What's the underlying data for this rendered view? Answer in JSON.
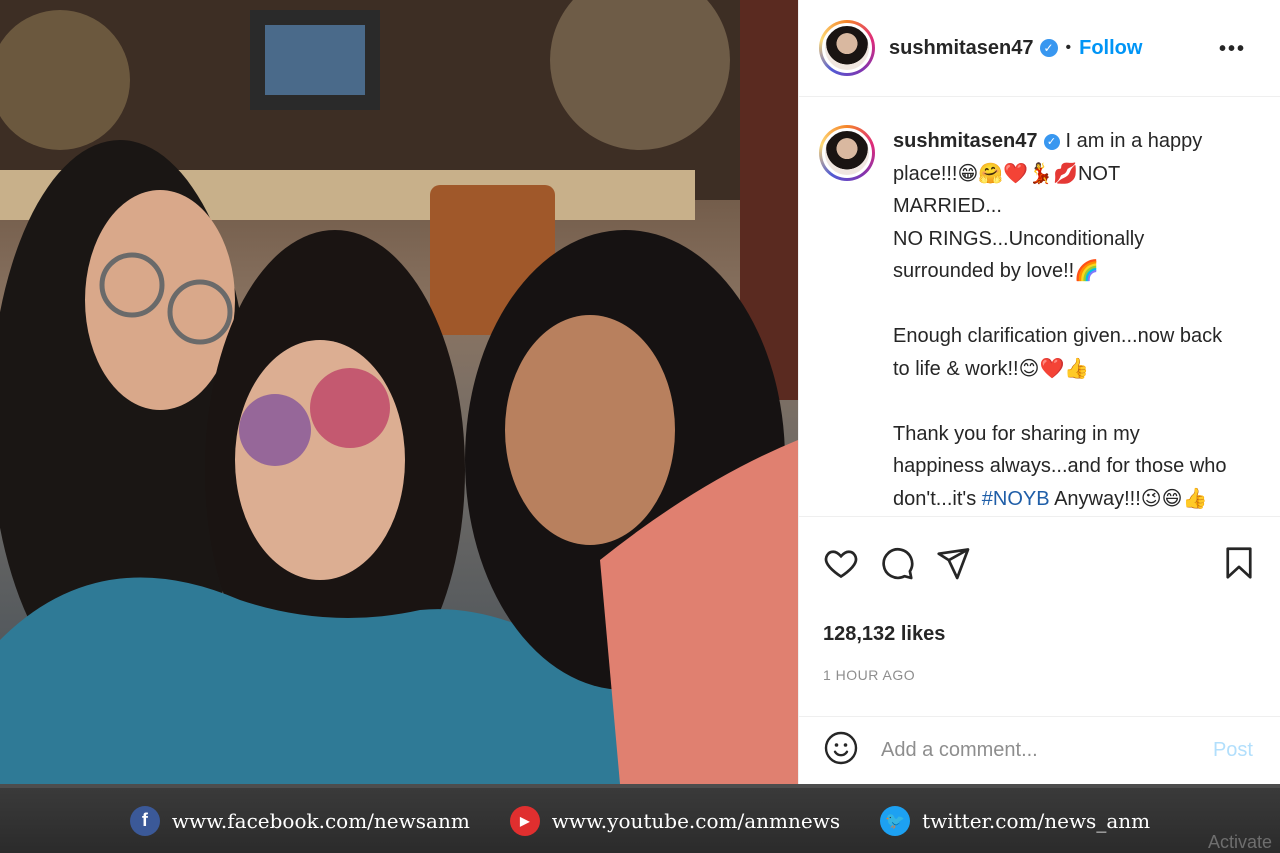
{
  "post": {
    "username": "sushmitasen47",
    "follow_label": "Follow",
    "dot": "•",
    "more_label": "•••",
    "caption_lines": [
      "I am in a happy place!!!😁🤗❤️💃💋NOT MARRIED...",
      "NO RINGS...Unconditionally",
      "surrounded by love!!🌈",
      "",
      "Enough clarification given...now back",
      "to life & work!!😊❤️👍",
      "",
      "Thank you for sharing in my",
      "happiness always...and for those who",
      "don't...it's"
    ],
    "hashtag": "#NOYB",
    "caption_tail": "Anyway!!!😉😄👍",
    "likes": "128,132 likes",
    "time": "1 HOUR AGO",
    "comment_placeholder": "Add a comment...",
    "post_label": "Post"
  },
  "icons": {
    "like": "heart-icon",
    "comment": "comment-icon",
    "share": "share-icon",
    "save": "bookmark-icon",
    "emoji": "emoji-icon",
    "verified": "verified-badge-icon"
  },
  "banner": {
    "facebook": "www.facebook.com/newsanm",
    "youtube": "www.youtube.com/anmnews",
    "twitter": "twitter.com/news_anm",
    "watermark": "Activate"
  },
  "colors": {
    "follow": "#0095f6",
    "verified": "#3897f0",
    "post_disabled": "#b2dffc",
    "banner_bg": "#2b2b2b"
  }
}
